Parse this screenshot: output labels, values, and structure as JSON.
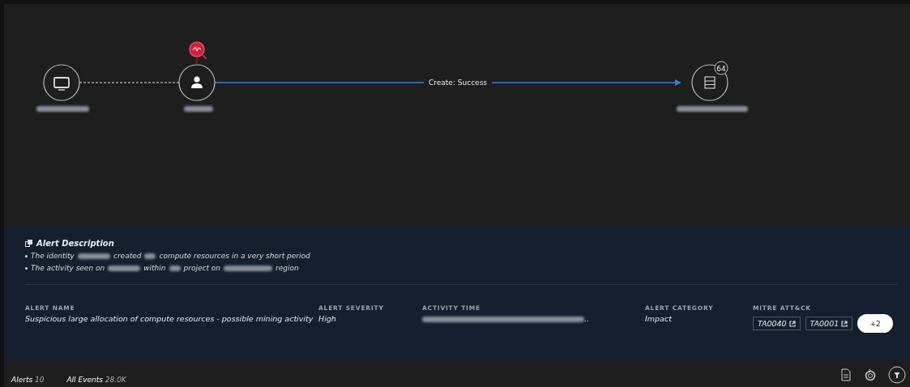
{
  "graph": {
    "edge_label": "Create: Success",
    "badge": "64"
  },
  "alert_description": {
    "title": "Alert Description",
    "bullets": [
      {
        "parts": [
          "The identity",
          "created",
          "compute resources in a very short period"
        ]
      },
      {
        "parts": [
          "The activity seen on",
          "within",
          "project on",
          "region"
        ]
      }
    ]
  },
  "fields": [
    {
      "label": "ALERT NAME",
      "value": "Suspicious large allocation of compute resources - possible mining activity"
    },
    {
      "label": "ALERT SEVERITY",
      "value": "High"
    },
    {
      "label": "ACTIVITY TIME",
      "value": ".."
    },
    {
      "label": "ALERT CATEGORY",
      "value": "Impact"
    }
  ],
  "mitre": {
    "label": "MITRE ATT&CK",
    "tags": [
      "TA0040",
      "TA0001"
    ],
    "more": "+2"
  },
  "status_bar": {
    "tabs": [
      {
        "label": "Alerts",
        "count": "10"
      },
      {
        "label": "All Events",
        "count": "28.0K"
      }
    ]
  }
}
